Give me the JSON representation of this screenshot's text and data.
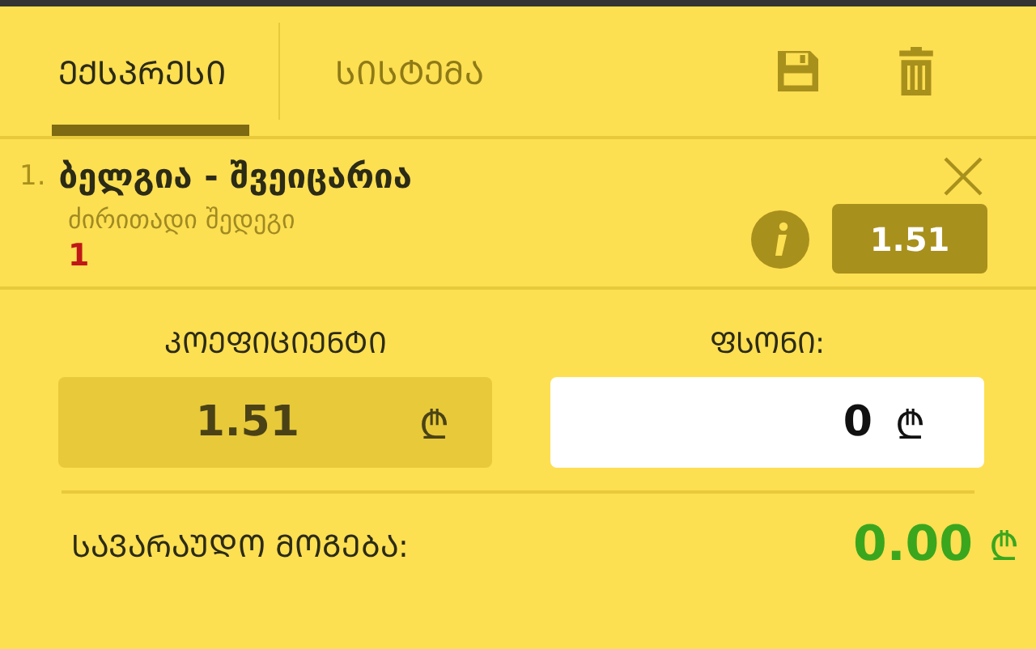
{
  "tabs": [
    {
      "label": "ᲔᲥᲡᲞᲠᲔᲡᲘ",
      "selected": true
    },
    {
      "label": "ᲡᲘᲡᲢᲔᲛᲐ",
      "selected": false
    }
  ],
  "bet": {
    "number": "1.",
    "match": "ბელგია - შვეიცარია",
    "market": "ძირითადი შედეგი",
    "pick": "1",
    "odds": "1.51"
  },
  "odds_field": {
    "label": "ᲙᲝᲔᲤᲘᲪᲘᲔᲜᲢᲘ",
    "value": "1.51",
    "currency": "₾"
  },
  "stake_field": {
    "label": "ᲤᲡᲝᲜᲘ:",
    "value": "0",
    "currency": "₾"
  },
  "payout": {
    "label": "ᲡᲐᲕᲐᲠᲐᲣᲓᲝ ᲛᲝᲒᲔᲑᲐ:",
    "value": "0.00",
    "currency": "₾"
  }
}
